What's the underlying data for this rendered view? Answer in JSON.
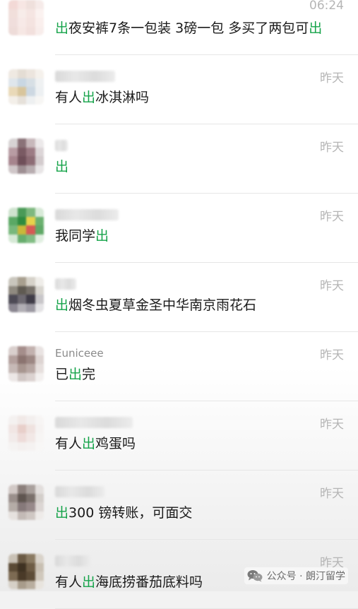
{
  "items": [
    {
      "top": "-20",
      "name": "",
      "time": "06:24",
      "pre": "",
      "hl": "出",
      "post": "夜安裤7条一包装 3磅一包 多买了两包可",
      "hl2": "出",
      "avatar": [
        "#f3d9d6",
        "#f7e6e3",
        "#efe0dc",
        "#f6ebe9",
        "#f1dfdb",
        "#f7ece9",
        "#f5e5e2",
        "#fbf2f0",
        "#f0dedc",
        "#f7e9e7",
        "#f4e3e0",
        "#faefed",
        "#eedcd9",
        "#f6e7e4",
        "#f2e0dd",
        "#f8edeb"
      ]
    },
    {
      "top": "78",
      "name": "",
      "time": "昨天",
      "pre": "有人",
      "hl": "出",
      "post": "冰淇淋吗",
      "hl2": "",
      "avatar": [
        "#efe9e2",
        "#e4ddd4",
        "#ece5de",
        "#f5f1ec",
        "#dfe6ec",
        "#c9d7e3",
        "#d7dfe5",
        "#eff1f2",
        "#e9d9b8",
        "#d8c59c",
        "#cdd8e2",
        "#edf0f2",
        "#f3efe9",
        "#e6e1da",
        "#eef0f1",
        "#f7f6f4"
      ]
    },
    {
      "top": "176",
      "name": "",
      "time": "昨天",
      "pre": "",
      "hl": "出",
      "post": "",
      "hl2": "",
      "avatar": [
        "#d7d3d4",
        "#8a7278",
        "#c7b8bb",
        "#ece9ea",
        "#b89ca3",
        "#7a5a63",
        "#9c7b84",
        "#dcd5d7",
        "#a6848d",
        "#6f4f59",
        "#8d6c75",
        "#d3cbcd",
        "#cfc6c8",
        "#9e8f93",
        "#b8adb0",
        "#e8e5e6"
      ]
    },
    {
      "top": "274",
      "name": "",
      "time": "昨天",
      "pre": "我同学",
      "hl": "出",
      "post": "",
      "hl2": "",
      "avatar": [
        "#cfe3cf",
        "#4a9a57",
        "#7eb87f",
        "#d8ead8",
        "#5aa864",
        "#2e8b3f",
        "#e7d24b",
        "#6bb06f",
        "#78b87c",
        "#c9b73a",
        "#d65a55",
        "#5fa866",
        "#d6e9d6",
        "#67ad6d",
        "#81bd84",
        "#e1efe1"
      ]
    },
    {
      "top": "372",
      "name": "",
      "time": "昨天",
      "pre": "",
      "hl": "出",
      "post": "烟冬虫夏草金圣中华南京雨花石",
      "hl2": "",
      "avatar": [
        "#c9c6bd",
        "#a89f8f",
        "#d6d2c9",
        "#efede9",
        "#8f8a80",
        "#5f5a52",
        "#77716a",
        "#d8d5cf",
        "#4d4a55",
        "#6e6a72",
        "#3f3c47",
        "#c8c6c9",
        "#8a8690",
        "#b1aeb4",
        "#9b98a1",
        "#e4e3e5"
      ]
    },
    {
      "top": "470",
      "name": "Euniceee",
      "time": "昨天",
      "pre": "已",
      "hl": "出",
      "post": "完",
      "hl2": "",
      "avatar": [
        "#d9cfcd",
        "#a58e8b",
        "#c2b1ae",
        "#e9e3e2",
        "#b3a09d",
        "#8b7470",
        "#9c8783",
        "#ddd4d2",
        "#c6b9b6",
        "#a89690",
        "#b7a7a3",
        "#e6dfdd",
        "#ece7e6",
        "#d1c7c5",
        "#dbd2d0",
        "#f3f0ef"
      ]
    },
    {
      "top": "568",
      "name": "",
      "time": "昨天",
      "pre": "有人",
      "hl": "出",
      "post": "鸡蛋吗",
      "hl2": "",
      "avatar": [
        "#f4f1f0",
        "#f1e9e7",
        "#f3efee",
        "#f7f5f4",
        "#f1e6e4",
        "#e8cfca",
        "#efe2df",
        "#f6f3f2",
        "#f2ebea",
        "#eedcd9",
        "#f2e8e6",
        "#f7f5f4",
        "#f5f3f2",
        "#f4f0ef",
        "#f5f2f1",
        "#f8f7f6"
      ]
    },
    {
      "top": "666",
      "name": "",
      "time": "昨天",
      "pre": "",
      "hl": "出",
      "post": "300 镑转账，可面交",
      "hl2": "",
      "avatar": [
        "#d2c9c6",
        "#8b7f7b",
        "#a9a09c",
        "#e2dedc",
        "#9a8f8b",
        "#5f5550",
        "#7a706b",
        "#d3ceca",
        "#b5aca7",
        "#86797a",
        "#97898a",
        "#dcd6d4",
        "#e6e1de",
        "#c3bab6",
        "#cfc7c3",
        "#eeebe9"
      ]
    },
    {
      "top": "764",
      "name": "",
      "time": "昨天",
      "pre": "有人",
      "hl": "出",
      "post": "海底捞番茄底料吗",
      "hl2": "",
      "avatar": [
        "#c9c1b5",
        "#6b5a44",
        "#8a7a62",
        "#d9d3ca",
        "#5b4a35",
        "#3f3222",
        "#6e5c45",
        "#c8bfb2",
        "#7d6b53",
        "#4a3a28",
        "#5d4c37",
        "#d0c8bc",
        "#d6d0c7",
        "#a89c8b",
        "#b9ae9f",
        "#e8e4de"
      ]
    }
  ],
  "watermark": {
    "text": "公众号 · 朗汀留学",
    "icon": "wechat-icon"
  },
  "colors": {
    "highlight": "#16a34a",
    "time": "#b5b5b5"
  }
}
